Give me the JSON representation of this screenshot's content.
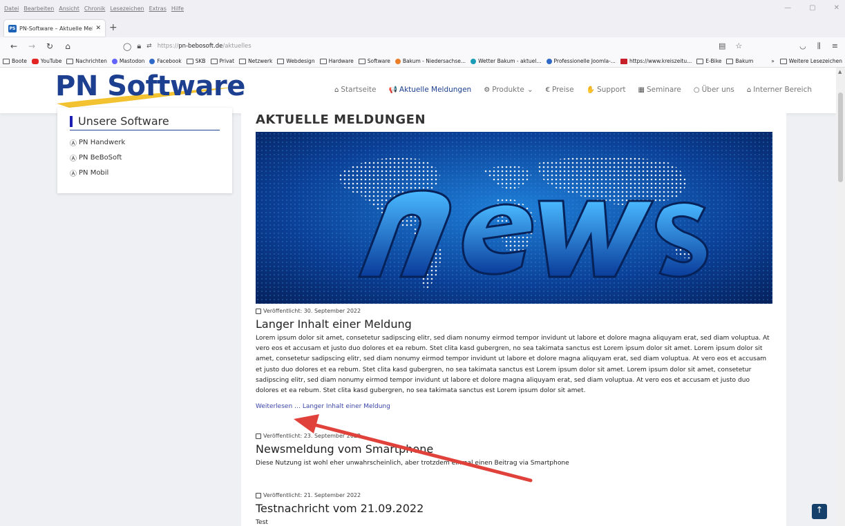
{
  "browser": {
    "menu": [
      "Datei",
      "Bearbeiten",
      "Ansicht",
      "Chronik",
      "Lesezeichen",
      "Extras",
      "Hilfe"
    ],
    "tab": {
      "title": "PN-Software – Aktuelle Meldun",
      "favicon": "PS"
    },
    "url_prefix": "https://",
    "url_host": "pn-bebosoft.de",
    "url_path": "/aktuelles",
    "bookmarks": [
      {
        "label": "Boote",
        "icon": "folder"
      },
      {
        "label": "YouTube",
        "icon": "red"
      },
      {
        "label": "Nachrichten",
        "icon": "folder"
      },
      {
        "label": "Mastodon",
        "icon": "purple"
      },
      {
        "label": "Facebook",
        "icon": "blue"
      },
      {
        "label": "SKB",
        "icon": "folder"
      },
      {
        "label": "Privat",
        "icon": "folder"
      },
      {
        "label": "Netzwerk",
        "icon": "folder"
      },
      {
        "label": "Webdesign",
        "icon": "folder"
      },
      {
        "label": "Hardware",
        "icon": "folder"
      },
      {
        "label": "Software",
        "icon": "folder"
      },
      {
        "label": "Bakum - Niedersachse...",
        "icon": "orange"
      },
      {
        "label": "Wetter Bakum - aktuel...",
        "icon": "teal"
      },
      {
        "label": "Professionelle Joomla-...",
        "icon": "blue"
      },
      {
        "label": "https://www.kreiszeitu...",
        "icon": "dred"
      },
      {
        "label": "E-Bike",
        "icon": "folder"
      },
      {
        "label": "Bakum",
        "icon": "folder"
      }
    ],
    "bookmarks_more": "Weitere Lesezeichen"
  },
  "site": {
    "logo": "PN Software",
    "nav": [
      {
        "label": "Startseite",
        "icon": "home-icon",
        "glyph": "⌂",
        "active": false
      },
      {
        "label": "Aktuelle Meldungen",
        "icon": "megaphone-icon",
        "glyph": "📢",
        "active": true
      },
      {
        "label": "Produkte",
        "icon": "cog-icon",
        "glyph": "⚙",
        "active": false,
        "dropdown": true
      },
      {
        "label": "Preise",
        "icon": "euro-icon",
        "glyph": "€",
        "active": false
      },
      {
        "label": "Support",
        "icon": "handshake-icon",
        "glyph": "✋",
        "active": false
      },
      {
        "label": "Seminare",
        "icon": "presentation-icon",
        "glyph": "▦",
        "active": false
      },
      {
        "label": "Über uns",
        "icon": "chat-icon",
        "glyph": "○",
        "active": false
      },
      {
        "label": "Interner Bereich",
        "icon": "building-icon",
        "glyph": "⌂",
        "active": false
      }
    ],
    "sidebar": {
      "heading": "Unsere Software",
      "items": [
        "PN Handwerk",
        "PN BeBoSoft",
        "PN Mobil"
      ]
    },
    "page_heading": "AKTUELLE MELDUNGEN",
    "hero_text": "news",
    "articles": [
      {
        "date": "Veröffentlicht: 30. September 2022",
        "title": "Langer Inhalt einer Meldung",
        "body": "Lorem ipsum dolor sit amet, consetetur sadipscing elitr, sed diam nonumy eirmod tempor invidunt ut labore et dolore magna aliquyam erat, sed diam voluptua. At vero eos et accusam et justo duo dolores et ea rebum. Stet clita kasd gubergren, no sea takimata sanctus est Lorem ipsum dolor sit amet. Lorem ipsum dolor sit amet, consetetur sadipscing elitr, sed diam nonumy eirmod tempor invidunt ut labore et dolore magna aliquyam erat, sed diam voluptua. At vero eos et accusam et justo duo dolores et ea rebum. Stet clita kasd gubergren, no sea takimata sanctus est Lorem ipsum dolor sit amet. Lorem ipsum dolor sit amet, consetetur sadipscing elitr, sed diam nonumy eirmod tempor invidunt ut labore et dolore magna aliquyam erat, sed diam voluptua. At vero eos et accusam et justo duo dolores et ea rebum. Stet clita kasd gubergren, no sea takimata sanctus est Lorem ipsum dolor sit amet.",
        "more": "Weiterlesen … Langer Inhalt einer Meldung"
      },
      {
        "date": "Veröffentlicht: 23. September 2022",
        "title": "Newsmeldung vom Smartphone",
        "body": "Diese Nutzung ist wohl eher unwahrscheinlich, aber trotzdem einmal einen Beitrag via Smartphone"
      },
      {
        "date": "Veröffentlicht: 21. September 2022",
        "title": "Testnachricht vom 21.09.2022",
        "body": "Test"
      }
    ]
  },
  "colors": {
    "brand_blue": "#1d3f8f",
    "logo_swoosh": "#f2c230",
    "annotation_arrow": "#e0413a",
    "link": "#3a45a8",
    "totop_bg": "#14406b"
  }
}
